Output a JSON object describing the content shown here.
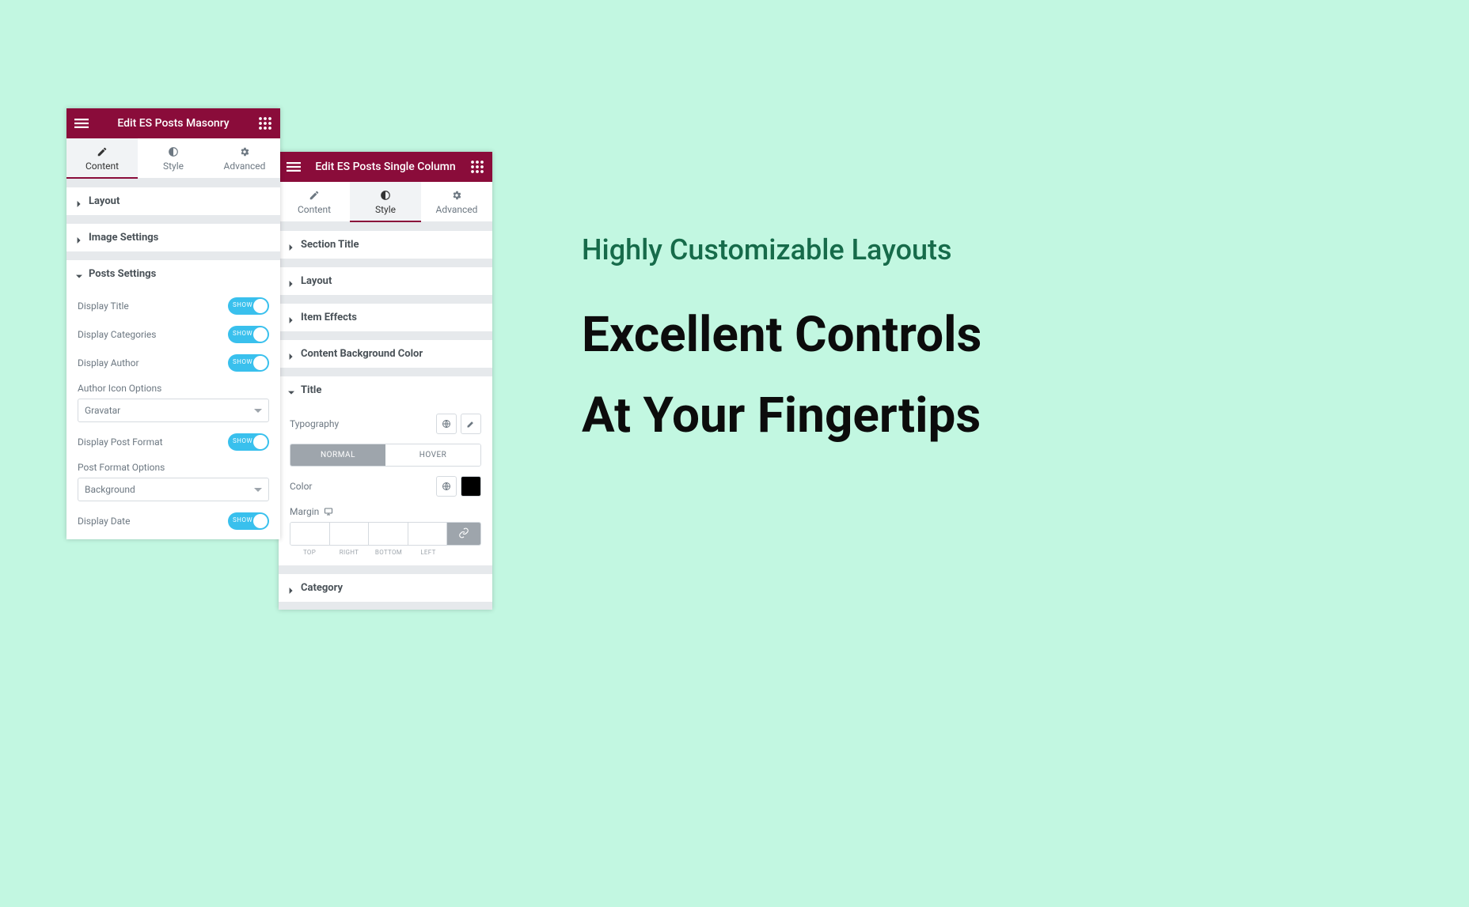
{
  "hero": {
    "subtitle": "Highly Customizable Layouts",
    "line1": "Excellent Controls",
    "line2": "At Your Fingertips"
  },
  "panel1": {
    "header_title": "Edit ES Posts Masonry",
    "tabs": {
      "t0": "Content",
      "t1": "Style",
      "t2": "Advanced"
    },
    "acc": {
      "layout": "Layout",
      "image": "Image Settings",
      "posts": "Posts Settings"
    },
    "labels": {
      "display_title": "Display Title",
      "display_categories": "Display Categories",
      "display_author": "Display Author",
      "author_icon_options": "Author Icon Options",
      "author_select": "Gravatar",
      "display_post_format": "Display Post Format",
      "post_format_options": "Post Format Options",
      "post_format_select": "Background",
      "display_date": "Display Date"
    },
    "toggle_text": "SHOW"
  },
  "panel2": {
    "header_title": "Edit ES Posts Single Column",
    "tabs": {
      "t0": "Content",
      "t1": "Style",
      "t2": "Advanced"
    },
    "acc": {
      "section_title": "Section Title",
      "layout": "Layout",
      "item_effects": "Item Effects",
      "content_bg": "Content Background Color",
      "title": "Title",
      "category": "Category"
    },
    "title_section": {
      "typography": "Typography",
      "normal": "NORMAL",
      "hover": "HOVER",
      "color": "Color",
      "margin": "Margin",
      "m_top": "TOP",
      "m_right": "RIGHT",
      "m_bottom": "BOTTOM",
      "m_left": "LEFT"
    }
  }
}
